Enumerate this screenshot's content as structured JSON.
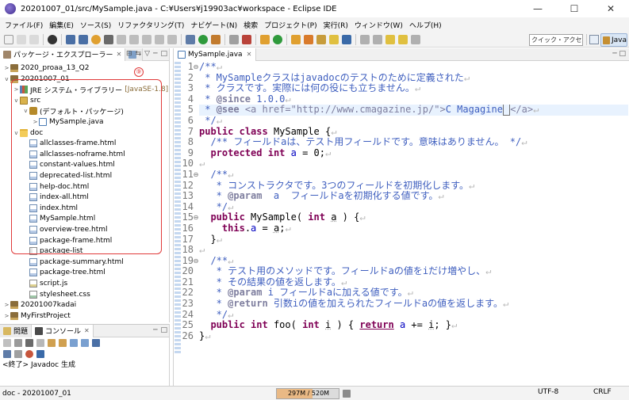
{
  "window": {
    "title": "20201007_01/src/MySample.java - C:¥Users¥j19903ac¥workspace - Eclipse IDE",
    "minimize": "—",
    "maximize": "☐",
    "close": "✕"
  },
  "menu": [
    "ファイル(F)",
    "編集(E)",
    "ソース(S)",
    "リファクタリング(T)",
    "ナビゲート(N)",
    "検索",
    "プロジェクト(P)",
    "実行(R)",
    "ウィンドウ(W)",
    "ヘルプ(H)"
  ],
  "toolbar": {
    "quick_access_placeholder": "クイック・アクセス",
    "perspective_label": "Java"
  },
  "package_explorer": {
    "tab_label": "パッケージ・エクスプローラー",
    "tab_close": "✕",
    "tab2_label": "",
    "annotation_number": "⑨",
    "tree": [
      {
        "label": "2020_proaa_13_Q2",
        "icon": "project",
        "indent": 0,
        "twisty": ">",
        "decor": ""
      },
      {
        "label": "20201007_01",
        "icon": "project",
        "indent": 0,
        "twisty": "v",
        "decor": ""
      },
      {
        "label": "JRE システム・ライブラリー",
        "icon": "library",
        "indent": 1,
        "twisty": ">",
        "decor": "[JavaSE-1.8]"
      },
      {
        "label": "src",
        "icon": "srcfolder",
        "indent": 1,
        "twisty": "v",
        "decor": ""
      },
      {
        "label": "(デフォルト・パッケージ)",
        "icon": "package",
        "indent": 2,
        "twisty": "v",
        "decor": ""
      },
      {
        "label": "MySample.java",
        "icon": "java",
        "indent": 3,
        "twisty": ">",
        "decor": ""
      },
      {
        "label": "doc",
        "icon": "folder",
        "indent": 1,
        "twisty": "v",
        "decor": ""
      },
      {
        "label": "allclasses-frame.html",
        "icon": "file-html",
        "indent": 2,
        "twisty": "",
        "decor": ""
      },
      {
        "label": "allclasses-noframe.html",
        "icon": "file-html",
        "indent": 2,
        "twisty": "",
        "decor": ""
      },
      {
        "label": "constant-values.html",
        "icon": "file-html",
        "indent": 2,
        "twisty": "",
        "decor": ""
      },
      {
        "label": "deprecated-list.html",
        "icon": "file-html",
        "indent": 2,
        "twisty": "",
        "decor": ""
      },
      {
        "label": "help-doc.html",
        "icon": "file-html",
        "indent": 2,
        "twisty": "",
        "decor": ""
      },
      {
        "label": "index-all.html",
        "icon": "file-html",
        "indent": 2,
        "twisty": "",
        "decor": ""
      },
      {
        "label": "index.html",
        "icon": "file-html",
        "indent": 2,
        "twisty": "",
        "decor": ""
      },
      {
        "label": "MySample.html",
        "icon": "file-html",
        "indent": 2,
        "twisty": "",
        "decor": ""
      },
      {
        "label": "overview-tree.html",
        "icon": "file-html",
        "indent": 2,
        "twisty": "",
        "decor": ""
      },
      {
        "label": "package-frame.html",
        "icon": "file-html",
        "indent": 2,
        "twisty": "",
        "decor": ""
      },
      {
        "label": "package-list",
        "icon": "file",
        "indent": 2,
        "twisty": "",
        "decor": ""
      },
      {
        "label": "package-summary.html",
        "icon": "file-html",
        "indent": 2,
        "twisty": "",
        "decor": ""
      },
      {
        "label": "package-tree.html",
        "icon": "file-html",
        "indent": 2,
        "twisty": "",
        "decor": ""
      },
      {
        "label": "script.js",
        "icon": "file-js",
        "indent": 2,
        "twisty": "",
        "decor": ""
      },
      {
        "label": "stylesheet.css",
        "icon": "file-css",
        "indent": 2,
        "twisty": "",
        "decor": ""
      },
      {
        "label": "20201007kadai",
        "icon": "project",
        "indent": 0,
        "twisty": ">",
        "decor": ""
      },
      {
        "label": "MyFirstProject",
        "icon": "project",
        "indent": 0,
        "twisty": ">",
        "decor": ""
      }
    ]
  },
  "bottom_views": {
    "problems_label": "問題",
    "console_label": "コンソール",
    "console_output": "<終了> Javadoc 生成"
  },
  "editor": {
    "tab_label": "MySample.java",
    "tab_close": "✕",
    "newline_mark": "↵",
    "lines": [
      {
        "n": "1",
        "fold": "⊖",
        "tokens": [
          {
            "t": "/**",
            "c": "comment"
          }
        ]
      },
      {
        "n": "2",
        "fold": "",
        "tokens": [
          {
            "t": " * MySampleクラスはjavadocのテストのために定義された",
            "c": "comment"
          }
        ]
      },
      {
        "n": "3",
        "fold": "",
        "tokens": [
          {
            "t": " * クラスです。実際には何の役にも立ちません。",
            "c": "comment"
          }
        ]
      },
      {
        "n": "4",
        "fold": "",
        "tokens": [
          {
            "t": " * ",
            "c": "comment"
          },
          {
            "t": "@since",
            "c": "tag"
          },
          {
            "t": " 1.0.0",
            "c": "comment"
          }
        ]
      },
      {
        "n": "5",
        "fold": "",
        "current": true,
        "tokens": [
          {
            "t": " * ",
            "c": "comment"
          },
          {
            "t": "@see",
            "c": "tag"
          },
          {
            "t": " ",
            "c": "comment"
          },
          {
            "t": "<a href=\"http://www.cmagazine.jp/\">",
            "c": "htmltag"
          },
          {
            "t": "C Magagine",
            "c": "comment"
          },
          {
            "t": " ",
            "c": "cursor"
          },
          {
            "t": "</a>",
            "c": "htmltag"
          }
        ]
      },
      {
        "n": "6",
        "fold": "",
        "tokens": [
          {
            "t": " */",
            "c": "comment"
          }
        ]
      },
      {
        "n": "7",
        "fold": "",
        "tokens": [
          {
            "t": "public",
            "c": "keyword"
          },
          {
            "t": " ",
            "c": ""
          },
          {
            "t": "class",
            "c": "keyword"
          },
          {
            "t": " MySample {",
            "c": ""
          }
        ]
      },
      {
        "n": "8",
        "fold": "",
        "tokens": [
          {
            "t": "  /** フィールドaは、テスト用フィールドです。意味はありません。 */",
            "c": "comment"
          }
        ]
      },
      {
        "n": "9",
        "fold": "",
        "tokens": [
          {
            "t": "  ",
            "c": ""
          },
          {
            "t": "protected",
            "c": "keyword"
          },
          {
            "t": " ",
            "c": ""
          },
          {
            "t": "int",
            "c": "keyword"
          },
          {
            "t": " ",
            "c": ""
          },
          {
            "t": "a",
            "c": "field"
          },
          {
            "t": " = 0;",
            "c": ""
          }
        ]
      },
      {
        "n": "10",
        "fold": "",
        "tokens": [
          {
            "t": "",
            "c": ""
          }
        ]
      },
      {
        "n": "11",
        "fold": "⊖",
        "tokens": [
          {
            "t": "  /**",
            "c": "comment"
          }
        ]
      },
      {
        "n": "12",
        "fold": "",
        "tokens": [
          {
            "t": "   * コンストラクタです。3つのフィールドを初期化します。",
            "c": "comment"
          }
        ]
      },
      {
        "n": "13",
        "fold": "",
        "tokens": [
          {
            "t": "   * ",
            "c": "comment"
          },
          {
            "t": "@param",
            "c": "tag"
          },
          {
            "t": "  a  フィールドaを初期化する値です。",
            "c": "comment"
          }
        ]
      },
      {
        "n": "14",
        "fold": "",
        "tokens": [
          {
            "t": "   */",
            "c": "comment"
          }
        ]
      },
      {
        "n": "15",
        "fold": "⊖",
        "tokens": [
          {
            "t": "  ",
            "c": ""
          },
          {
            "t": "public",
            "c": "keyword"
          },
          {
            "t": " MySample( ",
            "c": ""
          },
          {
            "t": "int",
            "c": "keyword"
          },
          {
            "t": " ",
            "c": ""
          },
          {
            "t": "a",
            "c": "dotted"
          },
          {
            "t": " ) {",
            "c": ""
          }
        ]
      },
      {
        "n": "16",
        "fold": "",
        "tokens": [
          {
            "t": "    ",
            "c": ""
          },
          {
            "t": "this",
            "c": "keyword"
          },
          {
            "t": ".",
            "c": ""
          },
          {
            "t": "a",
            "c": "field"
          },
          {
            "t": " = ",
            "c": ""
          },
          {
            "t": "a",
            "c": "dotted"
          },
          {
            "t": ";",
            "c": ""
          }
        ]
      },
      {
        "n": "17",
        "fold": "",
        "tokens": [
          {
            "t": "  }",
            "c": ""
          }
        ]
      },
      {
        "n": "18",
        "fold": "",
        "tokens": [
          {
            "t": "",
            "c": ""
          }
        ]
      },
      {
        "n": "19",
        "fold": "⊖",
        "tokens": [
          {
            "t": "  /**",
            "c": "comment"
          }
        ]
      },
      {
        "n": "20",
        "fold": "",
        "tokens": [
          {
            "t": "   * テスト用のメソッドです。フィールドaの値をiだけ増やし、",
            "c": "comment"
          }
        ]
      },
      {
        "n": "21",
        "fold": "",
        "tokens": [
          {
            "t": "   * その結果の値を返します。",
            "c": "comment"
          }
        ]
      },
      {
        "n": "22",
        "fold": "",
        "tokens": [
          {
            "t": "   * ",
            "c": "comment"
          },
          {
            "t": "@param",
            "c": "tag"
          },
          {
            "t": " i フィールドaに加える値です。",
            "c": "comment"
          }
        ]
      },
      {
        "n": "23",
        "fold": "",
        "tokens": [
          {
            "t": "   * ",
            "c": "comment"
          },
          {
            "t": "@return",
            "c": "tag"
          },
          {
            "t": " 引数iの値を加えられたフィールドaの値を返します。",
            "c": "comment"
          }
        ]
      },
      {
        "n": "24",
        "fold": "",
        "tokens": [
          {
            "t": "   */",
            "c": "comment"
          }
        ]
      },
      {
        "n": "25",
        "fold": "",
        "tokens": [
          {
            "t": "  ",
            "c": ""
          },
          {
            "t": "public",
            "c": "keyword"
          },
          {
            "t": " ",
            "c": ""
          },
          {
            "t": "int",
            "c": "keyword"
          },
          {
            "t": " foo( ",
            "c": ""
          },
          {
            "t": "int",
            "c": "keyword"
          },
          {
            "t": " ",
            "c": ""
          },
          {
            "t": "i",
            "c": "dotted"
          },
          {
            "t": " ) { ",
            "c": ""
          },
          {
            "t": "return",
            "c": "ret"
          },
          {
            "t": " ",
            "c": ""
          },
          {
            "t": "a",
            "c": "field"
          },
          {
            "t": " += ",
            "c": ""
          },
          {
            "t": "i",
            "c": "dotted"
          },
          {
            "t": "; }",
            "c": ""
          }
        ]
      },
      {
        "n": "26",
        "fold": "",
        "tokens": [
          {
            "t": "}",
            "c": ""
          }
        ]
      }
    ]
  },
  "status": {
    "selection": "doc - 20201007_01",
    "heap": "297M / 520M",
    "heap_used_fraction": 0.571,
    "encoding": "UTF-8",
    "eol": "CRLF"
  }
}
